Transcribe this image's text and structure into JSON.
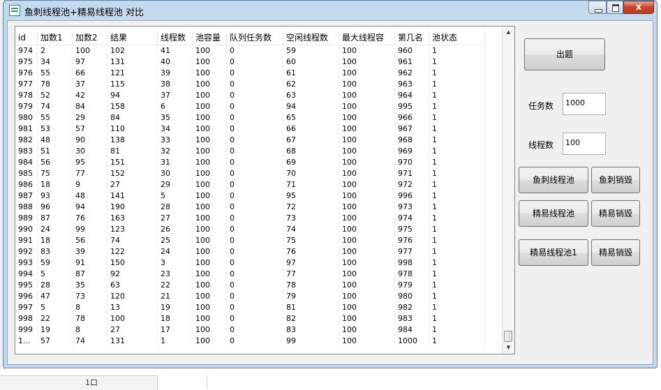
{
  "window": {
    "title": "鱼刺线程池+精易线程池 对比",
    "close_label": "x"
  },
  "background": {
    "taskbar_glyph": "1口"
  },
  "table": {
    "columns": [
      {
        "label": "id",
        "w": 32
      },
      {
        "label": "加数1",
        "w": 50
      },
      {
        "label": "加数2",
        "w": 50
      },
      {
        "label": "结果",
        "w": 72
      },
      {
        "label": "线程数",
        "w": 50
      },
      {
        "label": "池容量",
        "w": 49
      },
      {
        "label": "队列任务数",
        "w": 81
      },
      {
        "label": "空闲线程数",
        "w": 80
      },
      {
        "label": "最大线程容",
        "w": 80
      },
      {
        "label": "第几名",
        "w": 49
      },
      {
        "label": "池状态",
        "w": 80
      }
    ],
    "rows": [
      [
        "974",
        "2",
        "100",
        "102",
        "41",
        "100",
        "0",
        "59",
        "100",
        "960",
        "1"
      ],
      [
        "975",
        "34",
        "97",
        "131",
        "40",
        "100",
        "0",
        "60",
        "100",
        "961",
        "1"
      ],
      [
        "976",
        "55",
        "66",
        "121",
        "39",
        "100",
        "0",
        "61",
        "100",
        "962",
        "1"
      ],
      [
        "977",
        "78",
        "37",
        "115",
        "38",
        "100",
        "0",
        "62",
        "100",
        "963",
        "1"
      ],
      [
        "978",
        "52",
        "42",
        "94",
        "37",
        "100",
        "0",
        "63",
        "100",
        "964",
        "1"
      ],
      [
        "979",
        "74",
        "84",
        "158",
        "6",
        "100",
        "0",
        "94",
        "100",
        "995",
        "1"
      ],
      [
        "980",
        "55",
        "29",
        "84",
        "35",
        "100",
        "0",
        "65",
        "100",
        "966",
        "1"
      ],
      [
        "981",
        "53",
        "57",
        "110",
        "34",
        "100",
        "0",
        "66",
        "100",
        "967",
        "1"
      ],
      [
        "982",
        "48",
        "90",
        "138",
        "33",
        "100",
        "0",
        "67",
        "100",
        "968",
        "1"
      ],
      [
        "983",
        "51",
        "30",
        "81",
        "32",
        "100",
        "0",
        "68",
        "100",
        "969",
        "1"
      ],
      [
        "984",
        "56",
        "95",
        "151",
        "31",
        "100",
        "0",
        "69",
        "100",
        "970",
        "1"
      ],
      [
        "985",
        "75",
        "77",
        "152",
        "30",
        "100",
        "0",
        "70",
        "100",
        "971",
        "1"
      ],
      [
        "986",
        "18",
        "9",
        "27",
        "29",
        "100",
        "0",
        "71",
        "100",
        "972",
        "1"
      ],
      [
        "987",
        "93",
        "48",
        "141",
        "5",
        "100",
        "0",
        "95",
        "100",
        "996",
        "1"
      ],
      [
        "988",
        "96",
        "94",
        "190",
        "28",
        "100",
        "0",
        "72",
        "100",
        "973",
        "1"
      ],
      [
        "989",
        "87",
        "76",
        "163",
        "27",
        "100",
        "0",
        "73",
        "100",
        "974",
        "1"
      ],
      [
        "990",
        "24",
        "99",
        "123",
        "26",
        "100",
        "0",
        "74",
        "100",
        "975",
        "1"
      ],
      [
        "991",
        "18",
        "56",
        "74",
        "25",
        "100",
        "0",
        "75",
        "100",
        "976",
        "1"
      ],
      [
        "992",
        "83",
        "39",
        "122",
        "24",
        "100",
        "0",
        "76",
        "100",
        "977",
        "1"
      ],
      [
        "993",
        "59",
        "91",
        "150",
        "3",
        "100",
        "0",
        "97",
        "100",
        "998",
        "1"
      ],
      [
        "994",
        "5",
        "87",
        "92",
        "23",
        "100",
        "0",
        "77",
        "100",
        "978",
        "1"
      ],
      [
        "995",
        "28",
        "35",
        "63",
        "22",
        "100",
        "0",
        "78",
        "100",
        "979",
        "1"
      ],
      [
        "996",
        "47",
        "73",
        "120",
        "21",
        "100",
        "0",
        "79",
        "100",
        "980",
        "1"
      ],
      [
        "997",
        "5",
        "8",
        "13",
        "19",
        "100",
        "0",
        "81",
        "100",
        "982",
        "1"
      ],
      [
        "998",
        "22",
        "78",
        "100",
        "18",
        "100",
        "0",
        "82",
        "100",
        "983",
        "1"
      ],
      [
        "999",
        "19",
        "8",
        "27",
        "17",
        "100",
        "0",
        "83",
        "100",
        "984",
        "1"
      ],
      [
        "1...",
        "57",
        "74",
        "131",
        "1",
        "100",
        "0",
        "99",
        "100",
        "1000",
        "1"
      ]
    ]
  },
  "controls": {
    "generate_button": "出题",
    "task_count_label": "任务数",
    "task_count_value": "1000",
    "thread_count_label": "线程数",
    "thread_count_value": "100",
    "yuci_pool_button": "鱼刺线程池",
    "yuci_destroy_button": "鱼刺销毁",
    "jingyi_pool_button": "精易线程池",
    "jingyi_destroy_button": "精易销毁",
    "jingyi_pool1_button": "精易线程池1",
    "jingyi_destroy_button2": "精易销毁"
  }
}
